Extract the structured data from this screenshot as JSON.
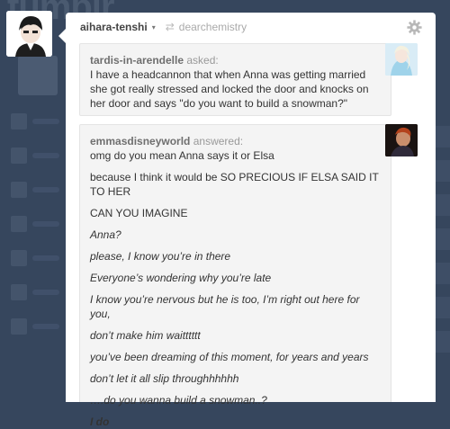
{
  "background": {
    "logo_text": "tumblr"
  },
  "post": {
    "author": "aihara-tenshi",
    "author_caret": "▾",
    "reblog_icon": "reblog-icon",
    "reblogged_from": "dearchemistry",
    "settings_icon": "gear-icon",
    "ask": {
      "asker": "tardis-in-arendelle",
      "asked_label": "asked:",
      "question": "I have a headcannon that when Anna was getting married she got really stressed and locked the door and knocks on her door and says \"do you want to build a snowman?\""
    },
    "answer": {
      "answerer": "emmasdisneyworld",
      "answered_label": "answered:",
      "lines": [
        "omg do you mean Anna says it or Elsa",
        "because I think it would be SO PRECIOUS IF ELSA SAID IT TO HER",
        "CAN YOU IMAGINE",
        "Anna?",
        "please, I know you’re in there",
        "Everyone’s wondering why you’re late",
        "I know you’re nervous but he is too, I’m right out here for you,",
        "don’t make him waitttttt",
        "you’ve been dreaming of this moment, for years and years",
        "don’t let it all slip throughhhhhh",
        "….do you wanna build a snowman..?",
        "I do"
      ]
    }
  },
  "colors": {
    "dashboard_bg": "#36465d",
    "card_bg": "#ffffff",
    "bubble_bg": "#f4f4f4"
  }
}
